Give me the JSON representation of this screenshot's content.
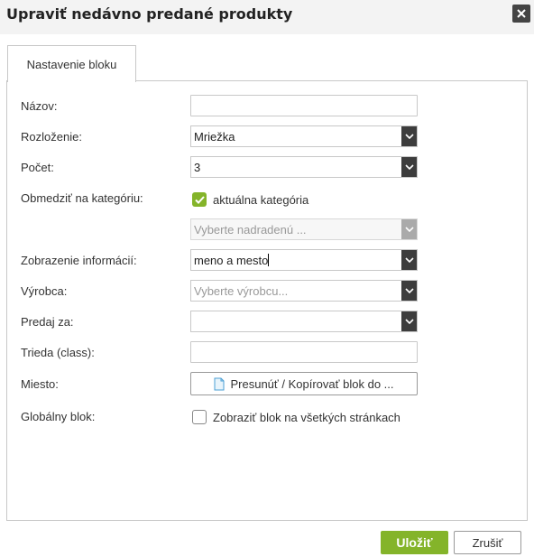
{
  "dialog": {
    "title": "Upraviť nedávno predané produkty",
    "close_icon": "close-icon"
  },
  "tabs": [
    {
      "label": "Nastavenie bloku",
      "active": true
    }
  ],
  "form": {
    "name": {
      "label": "Názov:",
      "value": ""
    },
    "layout": {
      "label": "Rozloženie:",
      "value": "Mriežka"
    },
    "count": {
      "label": "Počet:",
      "value": "3"
    },
    "category": {
      "label": "Obmedziť na kategóriu:",
      "checkbox_label": "aktuálna kategória",
      "checked": true,
      "parent_placeholder": "Vyberte nadradenú ..."
    },
    "info": {
      "label": "Zobrazenie informácií:",
      "value": "meno a mesto"
    },
    "manufacturer": {
      "label": "Výrobca:",
      "placeholder": "Vyberte výrobcu..."
    },
    "sell_via": {
      "label": "Predaj za:",
      "value": ""
    },
    "css_class": {
      "label": "Trieda (class):",
      "value": ""
    },
    "place": {
      "label": "Miesto:",
      "button_label": "Presunúť / Kopírovať blok do ..."
    },
    "global": {
      "label": "Globálny blok:",
      "checkbox_label": "Zobraziť blok na všetkých stránkach",
      "checked": false
    }
  },
  "footer": {
    "save_label": "Uložiť",
    "cancel_label": "Zrušiť"
  },
  "colors": {
    "accent": "#84b42a",
    "select_arrow": "#3d3d3d",
    "title_bar": "#f3f3f3"
  }
}
